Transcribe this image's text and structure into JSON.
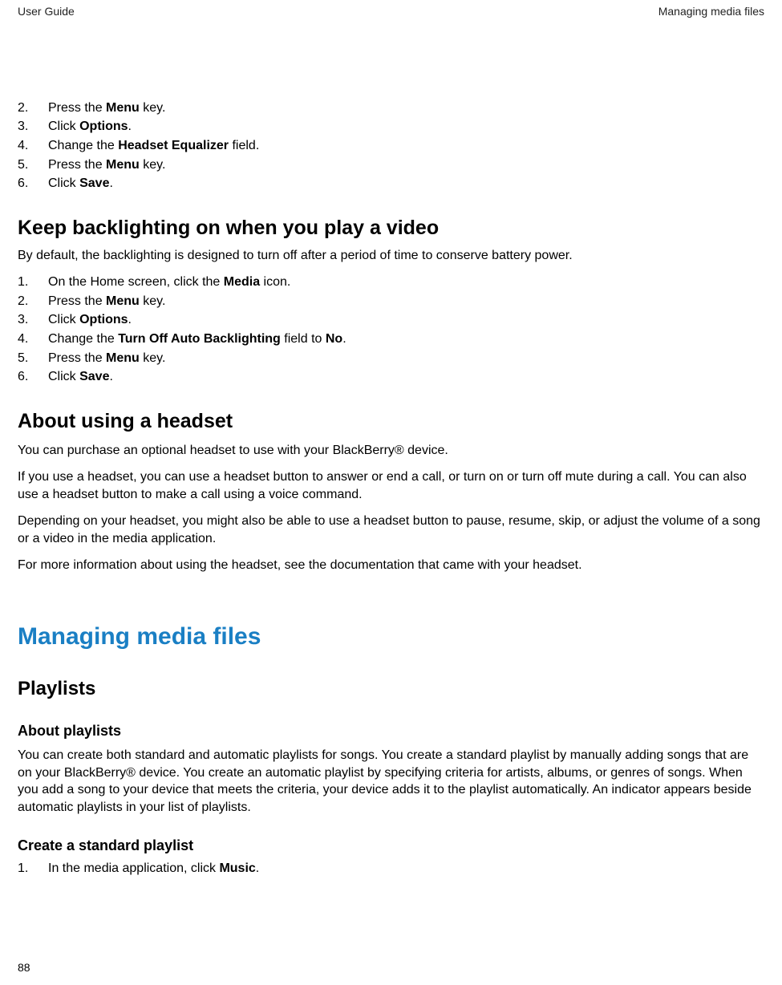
{
  "header": {
    "left": "User Guide",
    "right": "Managing media files"
  },
  "topSteps": [
    {
      "n": "2.",
      "pre": "Press the ",
      "bold": "Menu",
      "post": " key."
    },
    {
      "n": "3.",
      "pre": "Click ",
      "bold": "Options",
      "post": "."
    },
    {
      "n": "4.",
      "pre": "Change the ",
      "bold": "Headset Equalizer",
      "post": " field."
    },
    {
      "n": "5.",
      "pre": "Press the ",
      "bold": "Menu",
      "post": " key."
    },
    {
      "n": "6.",
      "pre": "Click ",
      "bold": "Save",
      "post": "."
    }
  ],
  "h2a": "Keep backlighting on when you play a video",
  "p_h2a": "By default, the backlighting is designed to turn off after a period of time to conserve battery power.",
  "stepsA": [
    {
      "n": "1.",
      "pre": "On the Home screen, click the ",
      "bold": "Media",
      "post": " icon."
    },
    {
      "n": "2.",
      "pre": "Press the ",
      "bold": "Menu",
      "post": " key."
    },
    {
      "n": "3.",
      "pre": "Click ",
      "bold": "Options",
      "post": "."
    },
    {
      "n": "4.",
      "pre": "Change the ",
      "bold": "Turn Off Auto Backlighting",
      "post": " field to ",
      "bold2": "No",
      "post2": "."
    },
    {
      "n": "5.",
      "pre": "Press the ",
      "bold": "Menu",
      "post": " key."
    },
    {
      "n": "6.",
      "pre": "Click ",
      "bold": "Save",
      "post": "."
    }
  ],
  "h2b": "About using a headset",
  "p_h2b_1": "You can purchase an optional headset to use with your BlackBerry® device.",
  "p_h2b_2": "If you use a headset, you can use a headset button to answer or end a call, or turn on or turn off mute during a call. You can also use a headset button to make a call using a voice command.",
  "p_h2b_3": "Depending on your headset, you might also be able to use a headset button to pause, resume, skip, or adjust the volume of a song or a video in the media application.",
  "p_h2b_4": "For more information about using the headset, see the documentation that came with your headset.",
  "h1": "Managing media files",
  "h2c": "Playlists",
  "h3a": "About playlists",
  "p_h3a": "You can create both standard and automatic playlists for songs. You create a standard playlist by manually adding songs that are on your BlackBerry® device. You create an automatic playlist by specifying criteria for artists, albums, or genres of songs. When you add a song to your device that meets the criteria, your device adds it to the playlist automatically. An indicator appears beside automatic playlists in your list of playlists.",
  "h3b": "Create a standard playlist",
  "stepsB": [
    {
      "n": "1.",
      "pre": "In the media application, click ",
      "bold": "Music",
      "post": "."
    }
  ],
  "pageNum": "88"
}
